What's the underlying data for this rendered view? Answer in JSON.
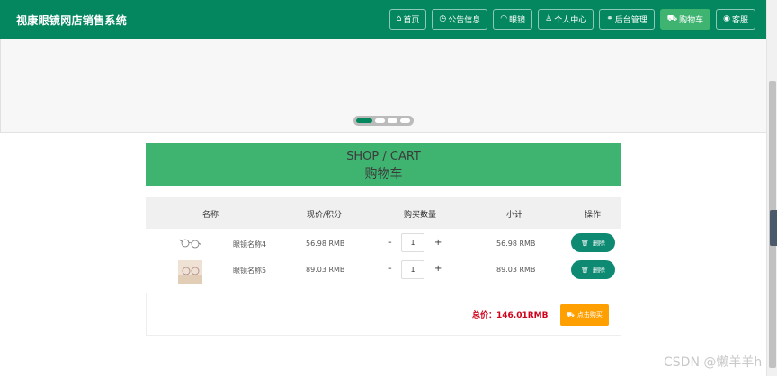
{
  "app": {
    "title": "视康眼镜网店销售系统"
  },
  "nav": {
    "items": [
      {
        "icon": "home-icon",
        "glyph": "⌂",
        "label": "首页"
      },
      {
        "icon": "clock-icon",
        "glyph": "◷",
        "label": "公告信息"
      },
      {
        "icon": "glasses-icon",
        "glyph": "◠",
        "label": "眼镜"
      },
      {
        "icon": "user-icon",
        "glyph": "♙",
        "label": "个人中心"
      },
      {
        "icon": "link-icon",
        "glyph": "⚭",
        "label": "后台管理"
      },
      {
        "icon": "cart-icon",
        "glyph": "⛟",
        "label": "购物车",
        "active": true
      },
      {
        "icon": "headset-icon",
        "glyph": "◉",
        "label": "客服"
      }
    ]
  },
  "banner": {
    "slides": 4,
    "active_index": 0
  },
  "shop_header": {
    "en": "SHOP / CART",
    "cn": "购物车"
  },
  "cart": {
    "columns": [
      "名称",
      "现价/积分",
      "购买数量",
      "小计",
      "操作"
    ],
    "rows": [
      {
        "name": "眼镜名称4",
        "price": "56.98 RMB",
        "minus": "-",
        "qty": "1",
        "plus": "+",
        "subtotal": "56.98 RMB",
        "delete_label": "删除"
      },
      {
        "name": "眼镜名称5",
        "price": "89.03 RMB",
        "minus": "-",
        "qty": "1",
        "plus": "+",
        "subtotal": "89.03 RMB",
        "delete_label": "删除"
      }
    ]
  },
  "total": {
    "label": "总价：146.01RMB",
    "buy_label": "点击购买"
  },
  "watermark": "CSDN @懒羊羊h",
  "colors": {
    "primary": "#04875e",
    "accent": "#3fb471",
    "danger": "#d0021b",
    "buy": "#ff9f00",
    "delete": "#0e8a73"
  }
}
